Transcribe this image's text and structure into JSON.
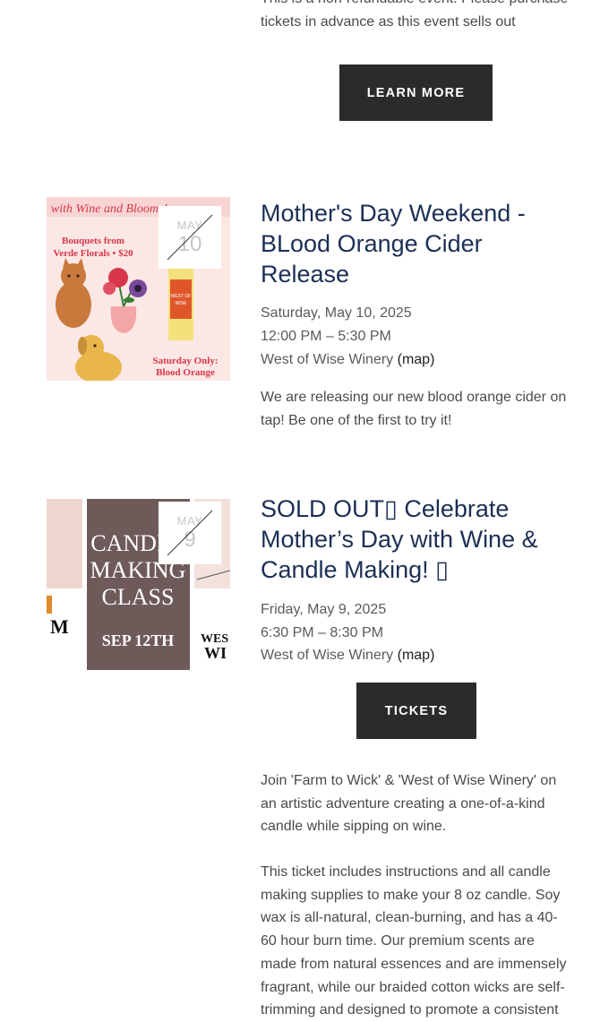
{
  "event0": {
    "description_tail": "This is a non-refundable event. Please purchase tickets in advance as this event sells out",
    "button_label": "LEARN MORE"
  },
  "event1": {
    "month": "MAY",
    "day": "10",
    "title": "Mother's Day Weekend - BLood Orange Cider Release",
    "date": "Saturday, May 10, 2025",
    "time": "12:00 PM – 5:30 PM",
    "venue": "West of Wise Winery",
    "map_label": "(map)",
    "description": "We are releasing our new blood orange cider on tap! Be one of the first to try it!",
    "image": {
      "headline": "with Wine and Blooms!",
      "bouquet_text": "Bouquets from Verde Florals • $20",
      "saturday_text": "Saturday Only: Blood Orange Cider Release",
      "bottle_label": "WEST OF WISE WINERY"
    }
  },
  "event2": {
    "month": "MAY",
    "day": "9",
    "title": "SOLD OUT▯ Celebrate Mother’s Day with Wine & Candle Making! ▯",
    "date": "Friday, May 9, 2025",
    "time": "6:30 PM – 8:30 PM",
    "venue": "West of Wise Winery",
    "map_label": "(map)",
    "button_label": "TICKETS",
    "description1": "Join 'Farm to Wick' & 'West of Wise Winery' on an artistic adventure creating a one-of-a-kind candle while sipping on wine.",
    "description2": "This ticket includes instructions and all candle making supplies to make your 8 oz candle. Soy wax is all-natural, clean-burning, and has a 40-60 hour burn time. Our premium scents are made from natural essences and are immensely fragrant, while our braided cotton wicks are self-trimming and designed to promote a consistent",
    "image": {
      "line1": "CANDLE",
      "line2": "MAKING",
      "line3": "CLASS",
      "date_text": "SEP 12TH",
      "left_text": "M",
      "right_text": "WES",
      "right_text2": "WI"
    }
  },
  "colors": {
    "title": "#1c2f54",
    "button_bg": "#2b2b2b",
    "body_text": "#4a4a4a"
  }
}
